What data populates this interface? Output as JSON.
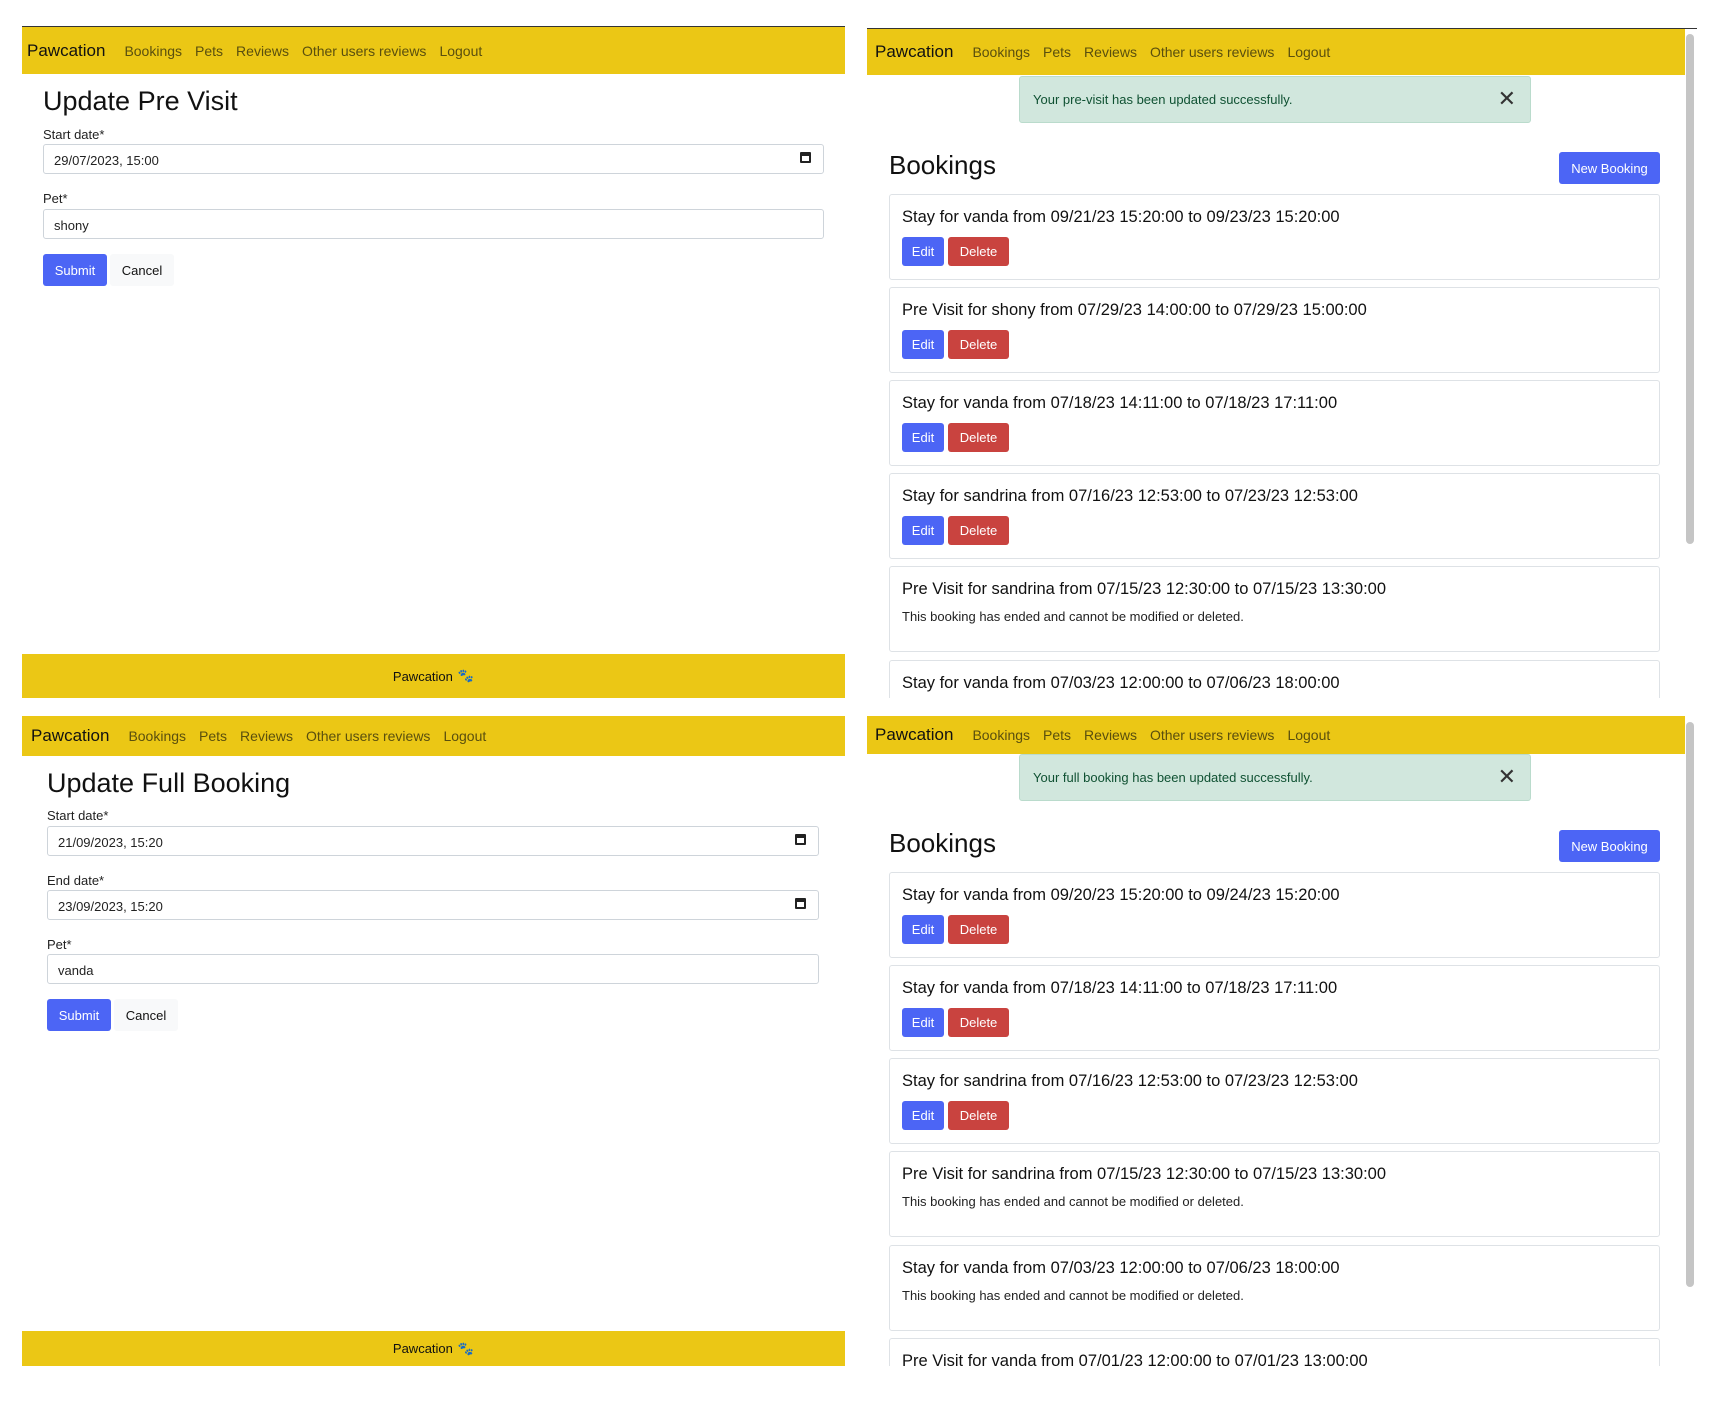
{
  "nav": {
    "brand": "Pawcation",
    "items": [
      "Bookings",
      "Pets",
      "Reviews",
      "Other users reviews",
      "Logout"
    ]
  },
  "footer": {
    "label": "Pawcation",
    "icon": "paw-icon"
  },
  "pre_visit_form": {
    "title": "Update Pre Visit",
    "start_label": "Start date*",
    "start_value": "29/07/2023, 15:00",
    "pet_label": "Pet*",
    "pet_value": "shony",
    "submit": "Submit",
    "cancel": "Cancel"
  },
  "full_booking_form": {
    "title": "Update Full Booking",
    "start_label": "Start date*",
    "start_value": "21/09/2023, 15:20",
    "end_label": "End date*",
    "end_value": "23/09/2023, 15:20",
    "pet_label": "Pet*",
    "pet_value": "vanda",
    "submit": "Submit",
    "cancel": "Cancel"
  },
  "bookings_pre": {
    "alert": "Your pre-visit has been updated successfully.",
    "title": "Bookings",
    "new_booking": "New Booking",
    "cards": [
      {
        "title": "Stay for vanda from 09/21/23 15:20:00 to 09/23/23 15:20:00",
        "editable": true
      },
      {
        "title": "Pre Visit for shony from 07/29/23 14:00:00 to 07/29/23 15:00:00",
        "editable": true
      },
      {
        "title": "Stay for vanda from 07/18/23 14:11:00 to 07/18/23 17:11:00",
        "editable": true
      },
      {
        "title": "Stay for sandrina from 07/16/23 12:53:00 to 07/23/23 12:53:00",
        "editable": true
      },
      {
        "title": "Pre Visit for sandrina from 07/15/23 12:30:00 to 07/15/23 13:30:00",
        "editable": false,
        "note": "This booking has ended and cannot be modified or deleted."
      },
      {
        "title": "Stay for vanda from 07/03/23 12:00:00 to 07/06/23 18:00:00",
        "editable": false
      }
    ]
  },
  "bookings_full": {
    "alert": "Your full booking has been updated successfully.",
    "title": "Bookings",
    "new_booking": "New Booking",
    "cards": [
      {
        "title": "Stay for vanda from 09/20/23 15:20:00 to 09/24/23 15:20:00",
        "editable": true
      },
      {
        "title": "Stay for vanda from 07/18/23 14:11:00 to 07/18/23 17:11:00",
        "editable": true
      },
      {
        "title": "Stay for sandrina from 07/16/23 12:53:00 to 07/23/23 12:53:00",
        "editable": true
      },
      {
        "title": "Pre Visit for sandrina from 07/15/23 12:30:00 to 07/15/23 13:30:00",
        "editable": false,
        "note": "This booking has ended and cannot be modified or deleted."
      },
      {
        "title": "Stay for vanda from 07/03/23 12:00:00 to 07/06/23 18:00:00",
        "editable": false,
        "note": "This booking has ended and cannot be modified or deleted."
      },
      {
        "title": "Pre Visit for vanda from 07/01/23 12:00:00 to 07/01/23 13:00:00",
        "editable": false
      }
    ]
  },
  "buttons": {
    "edit": "Edit",
    "delete": "Delete"
  },
  "colors": {
    "navbar": "#ebc715",
    "primary": "#4c65f5",
    "danger": "#c9433f",
    "alert_bg": "#d1e7dd"
  }
}
